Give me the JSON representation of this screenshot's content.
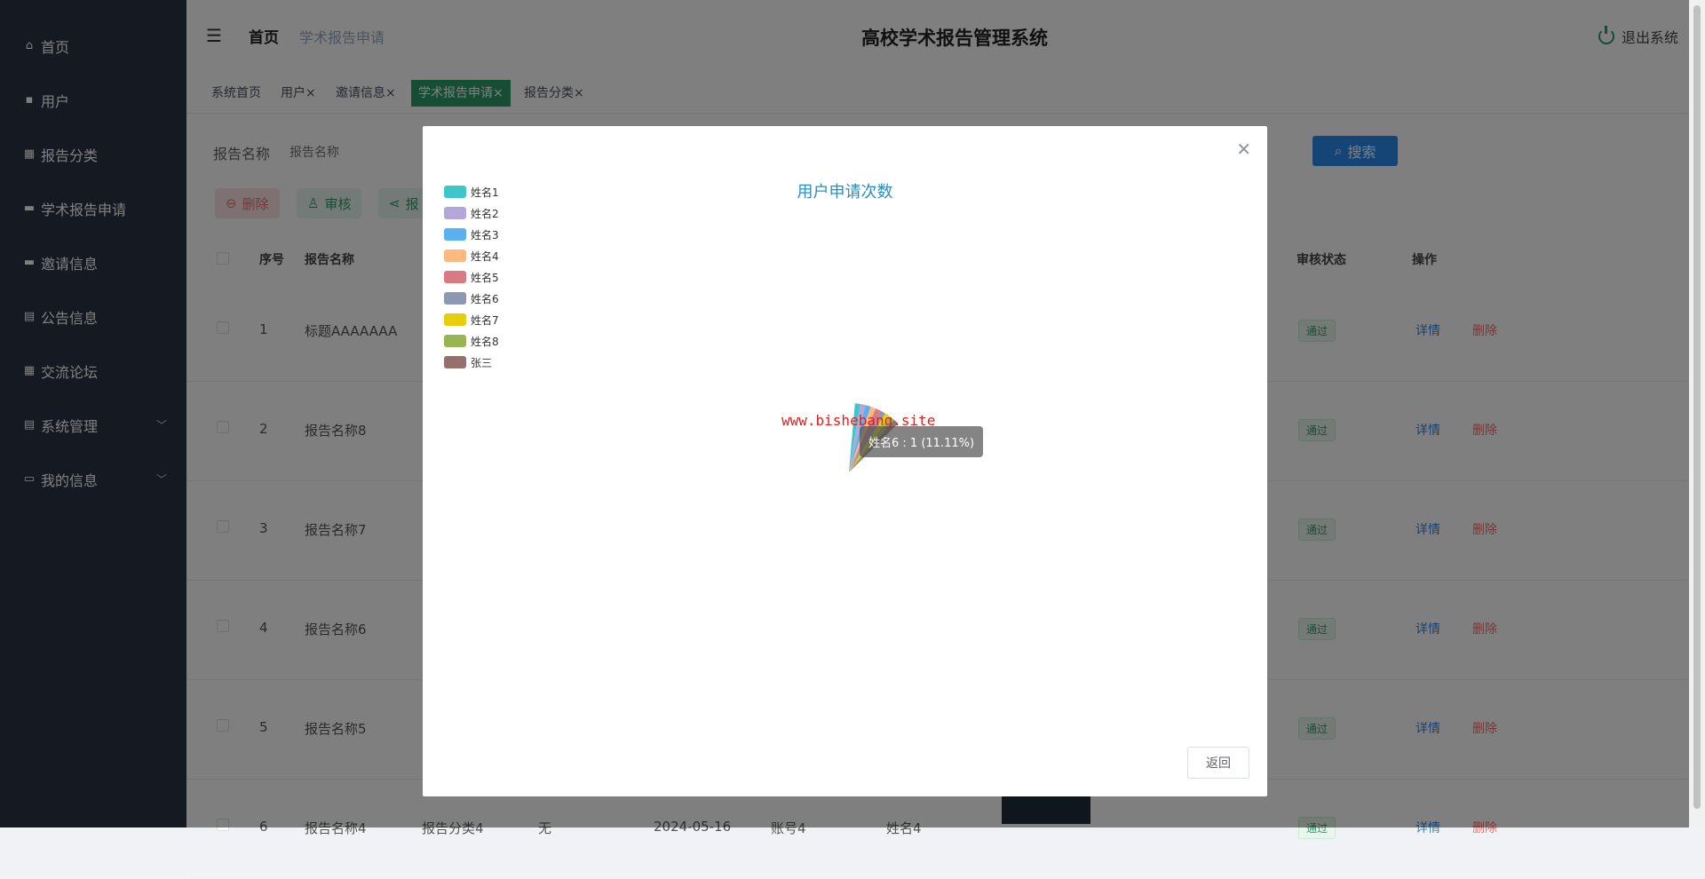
{
  "app": {
    "title": "高校学术报告管理系统",
    "logout": "退出系统"
  },
  "breadcrumb": {
    "home": "首页",
    "current": "学术报告申请"
  },
  "sidebar": {
    "items": [
      {
        "label": "首页",
        "icon": "home-icon"
      },
      {
        "label": "用户",
        "icon": "user-icon"
      },
      {
        "label": "报告分类",
        "icon": "grid-icon"
      },
      {
        "label": "学术报告申请",
        "icon": "briefcase-icon"
      },
      {
        "label": "邀请信息",
        "icon": "invite-icon"
      },
      {
        "label": "公告信息",
        "icon": "clipboard-icon"
      },
      {
        "label": "交流论坛",
        "icon": "grid-icon"
      },
      {
        "label": "系统管理",
        "icon": "clipboard-icon",
        "expandable": true
      },
      {
        "label": "我的信息",
        "icon": "card-icon",
        "expandable": true
      }
    ]
  },
  "tabs": [
    {
      "label": "系统首页"
    },
    {
      "label": "用户×"
    },
    {
      "label": "邀请信息×"
    },
    {
      "label": "学术报告申请×",
      "active": true
    },
    {
      "label": "报告分类×"
    }
  ],
  "search": {
    "label": "报告名称",
    "placeholder": "报告名称",
    "button": "搜索"
  },
  "actions": {
    "delete": "删除",
    "audit": "审核",
    "report": "报"
  },
  "table": {
    "headers": {
      "index": "序号",
      "name": "报告名称",
      "status": "审核状态",
      "ops": "操作"
    },
    "rows": [
      {
        "index": "1",
        "name": "标题AAAAAAA",
        "status": "通过"
      },
      {
        "index": "2",
        "name": "报告名称8",
        "status": "通过"
      },
      {
        "index": "3",
        "name": "报告名称7",
        "status": "通过"
      },
      {
        "index": "4",
        "name": "报告名称6",
        "status": "通过"
      },
      {
        "index": "5",
        "name": "报告名称5",
        "status": "通过"
      },
      {
        "index": "6",
        "name": "报告名称4",
        "category": "报告分类4",
        "note": "无",
        "date": "2024-05-16",
        "account": "账号4",
        "person": "姓名4",
        "status": "通过"
      }
    ],
    "op_detail": "详情",
    "op_delete": "删除"
  },
  "modal": {
    "back_button": "返回",
    "watermark": "www.bishebang.site",
    "tooltip": "姓名6 : 1 (11.11%)"
  },
  "chart_data": {
    "type": "pie",
    "title": "用户申请次数",
    "legend_position": "top-left",
    "categories": [
      "姓名1",
      "姓名2",
      "姓名3",
      "姓名4",
      "姓名5",
      "姓名6",
      "姓名7",
      "姓名8",
      "张三"
    ],
    "values": [
      1,
      1,
      1,
      1,
      1,
      1,
      1,
      1,
      1
    ],
    "colors": [
      "#3ec7c9",
      "#b5a6da",
      "#5ab1ef",
      "#ffb980",
      "#d87a80",
      "#8d98b3",
      "#e5cf0d",
      "#97b552",
      "#95706d"
    ]
  }
}
